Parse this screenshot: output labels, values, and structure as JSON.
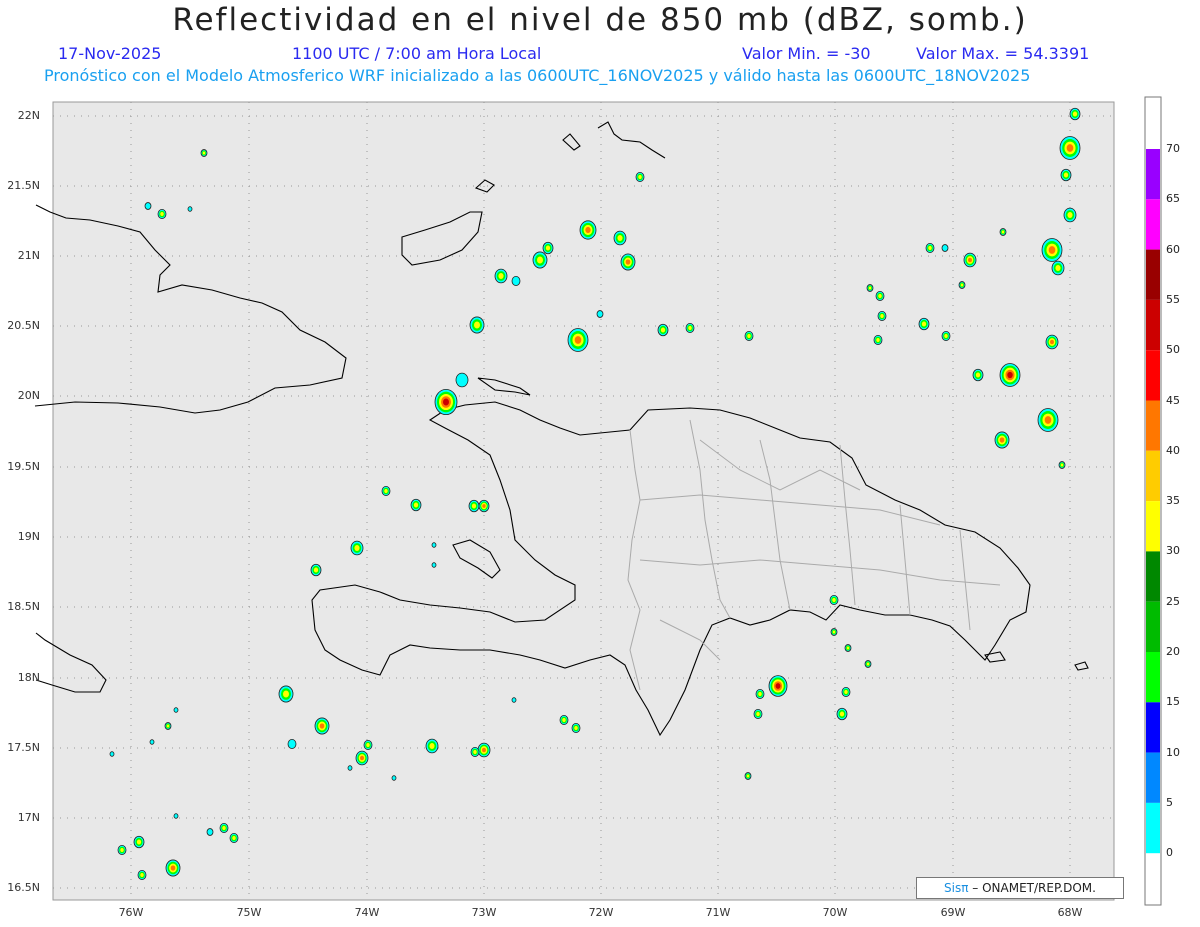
{
  "header": {
    "title": "Reflectividad en el nivel de 850 mb (dBZ, somb.)",
    "date": "17-Nov-2025",
    "time": "1100 UTC / 7:00 am Hora Local",
    "min": "Valor Min. = -30",
    "max": "Valor Max. = 54.3391",
    "model_info": "Pronóstico con el Modelo Atmosferico WRF inicializado a las 0600UTC_16NOV2025 y válido hasta las  0600UTC_18NOV2025"
  },
  "axes": {
    "lat_labels": [
      "22N",
      "21.5N",
      "21N",
      "20.5N",
      "20N",
      "19.5N",
      "19N",
      "18.5N",
      "18N",
      "17.5N",
      "17N",
      "16.5N"
    ],
    "lon_labels": [
      "76W",
      "75W",
      "74W",
      "73W",
      "72W",
      "71W",
      "70W",
      "69W",
      "68W"
    ]
  },
  "colorbar": {
    "labels": [
      "70",
      "65",
      "60",
      "55",
      "50",
      "45",
      "40",
      "35",
      "30",
      "25",
      "20",
      "15",
      "10",
      "5",
      "0"
    ],
    "colors": [
      "#9900ff",
      "#ff00ff",
      "#990000",
      "#cc0000",
      "#ff0000",
      "#ff7700",
      "#ffcc00",
      "#ffff00",
      "#008800",
      "#00bb00",
      "#00ff00",
      "#0000ff",
      "#0088ff",
      "#00ffff"
    ]
  },
  "credit": {
    "logo": "Sisπ",
    "text": "– ONAMET/REP.DOM."
  },
  "map": {
    "type": "precipitation-reflectivity",
    "region": "Hispaniola and surrounding Caribbean",
    "lat_range": [
      16.5,
      22
    ],
    "lon_range": [
      -76.6,
      -67.6
    ]
  }
}
